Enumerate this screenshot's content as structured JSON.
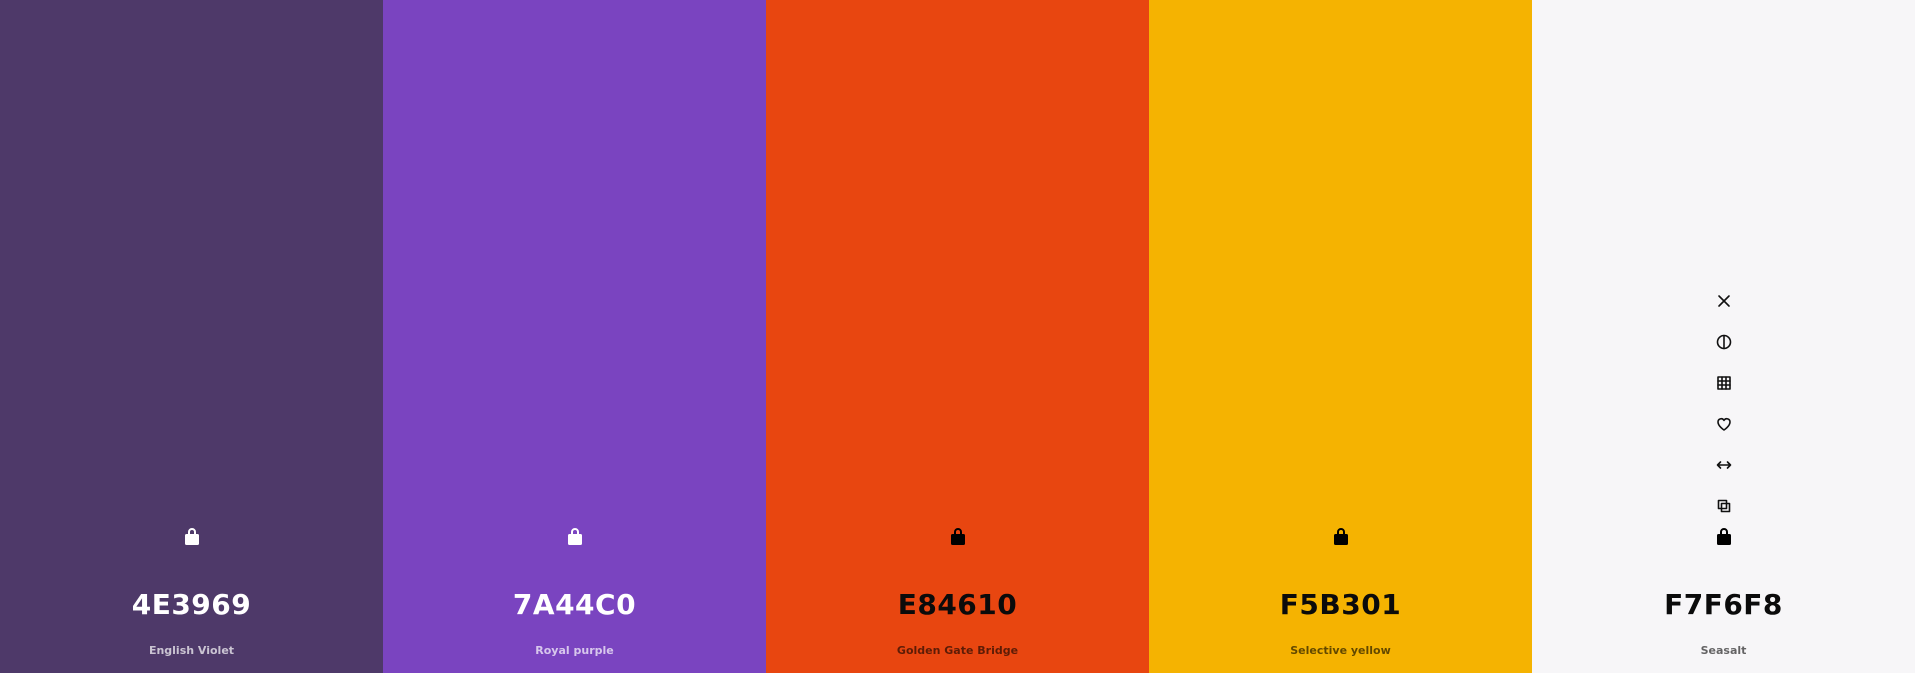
{
  "swatches": [
    {
      "hex": "4E3969",
      "name": "English Violet",
      "color": "#4E3969",
      "text_tone": "light"
    },
    {
      "hex": "7A44C0",
      "name": "Royal purple",
      "color": "#7A44C0",
      "text_tone": "light"
    },
    {
      "hex": "E84610",
      "name": "Golden Gate Bridge",
      "color": "#E84610",
      "text_tone": "dark"
    },
    {
      "hex": "F5B301",
      "name": "Selective yellow",
      "color": "#F5B301",
      "text_tone": "dark"
    },
    {
      "hex": "F7F6F8",
      "name": "Seasalt",
      "color": "#F7F6F8",
      "text_tone": "dark"
    }
  ],
  "hover_tools": [
    "close-icon",
    "contrast-icon",
    "grid-icon",
    "heart-icon",
    "drag-horizontal-icon",
    "copy-icon",
    "lock-icon"
  ]
}
